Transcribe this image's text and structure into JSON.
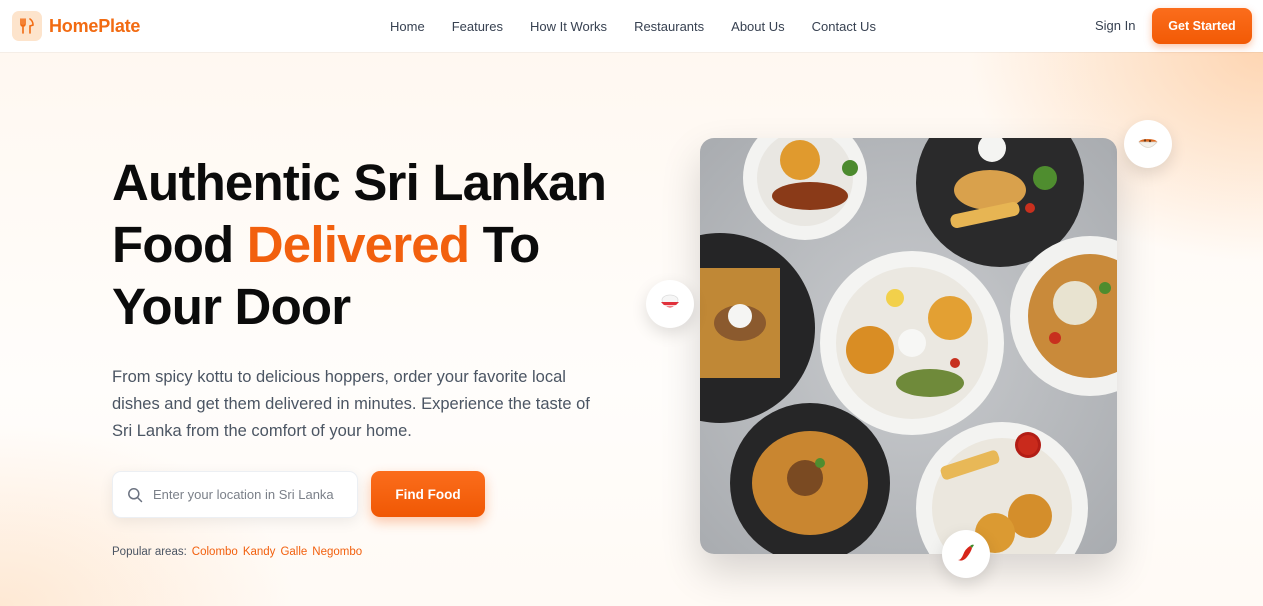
{
  "brand": {
    "name": "HomePlate",
    "logo_icon": "fork-knife-icon"
  },
  "nav": {
    "links": [
      "Home",
      "Features",
      "How It Works",
      "Restaurants",
      "About Us",
      "Contact Us"
    ],
    "sign_in": "Sign In",
    "cta": "Get Started"
  },
  "hero": {
    "headline_1": "Authentic Sri Lankan",
    "headline_2a": "Food ",
    "headline_2b": "Delivered",
    "headline_2c": " To",
    "headline_3": "Your Door",
    "subtext": "From spicy kottu to delicious hoppers, order your favorite local dishes and get them delivered in minutes. Experience the taste of Sri Lanka from the comfort of your home.",
    "search_placeholder": "Enter your location in Sri Lanka",
    "find_button": "Find Food",
    "popular_label": "Popular areas:",
    "popular_areas": [
      "Colombo",
      "Kandy",
      "Galle",
      "Negombo"
    ]
  },
  "badges": {
    "top_right": "curry-bowl-icon",
    "left": "rice-bowl-icon",
    "bottom": "chili-pepper-icon"
  },
  "colors": {
    "accent": "#f2600e",
    "button": "#f25a05",
    "heading": "#0b0b0b",
    "body_text": "#4b5563"
  }
}
